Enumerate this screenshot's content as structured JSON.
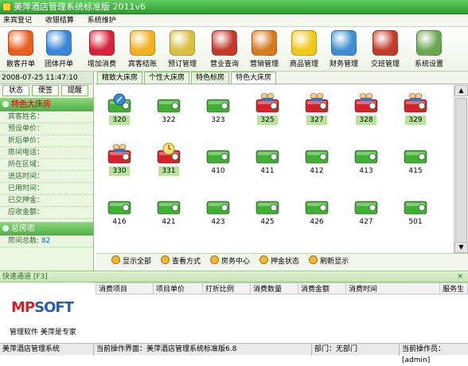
{
  "window": {
    "title": "美萍酒店管理系统标准版 2011v6"
  },
  "menu": [
    "来宾登记",
    "收银结算",
    "系统维护"
  ],
  "toolbar": [
    {
      "label": "散客开单",
      "icon": "guest-icon",
      "color": "#e85f20"
    },
    {
      "label": "团体开单",
      "icon": "group-icon",
      "color": "#3a86d8"
    },
    {
      "label": "增加消费",
      "icon": "plus-icon",
      "color": "#d8203a"
    },
    {
      "label": "宾客结账",
      "icon": "money-icon",
      "color": "#f2b01c"
    },
    {
      "label": "预订管理",
      "icon": "clock-icon",
      "color": "#d9c040"
    },
    {
      "label": "营业查询",
      "icon": "search-icon",
      "color": "#c4392b"
    },
    {
      "label": "营销管理",
      "icon": "people-icon",
      "color": "#d87a20"
    },
    {
      "label": "商品管理",
      "icon": "star-icon",
      "color": "#f0c818"
    },
    {
      "label": "财务管理",
      "icon": "books-icon",
      "color": "#3c8fd0"
    },
    {
      "label": "交班管理",
      "icon": "exit-icon",
      "color": "#c23a2a"
    },
    {
      "label": "系统设置",
      "icon": "gear-icon",
      "color": "#6aa84f"
    }
  ],
  "datetime": "2008-07-25 11:47:10",
  "left_tabs": [
    "状态",
    "便签",
    "提醒"
  ],
  "room_section_title": "特色大床房",
  "info_labels": [
    "宾客姓名：",
    "预设单价：",
    "折后单价：",
    "房间电话：",
    "所在区域：",
    "进店时间：",
    "已用时间：",
    "已交押金：",
    "应收金额："
  ],
  "overview": {
    "title": "总房态",
    "label": "房间总数:",
    "value": "82"
  },
  "quick_channel": "快速通道 [F3]",
  "room_tabs": [
    "精致大床房",
    "个性大床房",
    "特色标房",
    "特色大床房"
  ],
  "rooms": [
    {
      "number": "320",
      "status": "vacant-dirty",
      "highlight": true
    },
    {
      "number": "322",
      "status": "vacant",
      "highlight": false
    },
    {
      "number": "323",
      "status": "vacant",
      "highlight": false
    },
    {
      "number": "325",
      "status": "occupied",
      "highlight": true
    },
    {
      "number": "327",
      "status": "occupied",
      "highlight": true
    },
    {
      "number": "328",
      "status": "occupied",
      "highlight": true
    },
    {
      "number": "329",
      "status": "occupied",
      "highlight": true
    },
    {
      "number": "330",
      "status": "occupied",
      "highlight": true
    },
    {
      "number": "331",
      "status": "reserved",
      "highlight": true
    },
    {
      "number": "410",
      "status": "vacant",
      "highlight": false
    },
    {
      "number": "411",
      "status": "vacant",
      "highlight": false
    },
    {
      "number": "412",
      "status": "vacant",
      "highlight": false
    },
    {
      "number": "413",
      "status": "vacant",
      "highlight": false
    },
    {
      "number": "415",
      "status": "vacant",
      "highlight": false
    },
    {
      "number": "416",
      "status": "vacant",
      "highlight": false
    },
    {
      "number": "421",
      "status": "vacant",
      "highlight": false
    },
    {
      "number": "423",
      "status": "vacant",
      "highlight": false
    },
    {
      "number": "425",
      "status": "vacant",
      "highlight": false
    },
    {
      "number": "426",
      "status": "vacant",
      "highlight": false
    },
    {
      "number": "427",
      "status": "vacant",
      "highlight": false
    },
    {
      "number": "501",
      "status": "vacant",
      "highlight": false
    }
  ],
  "actions": [
    "显示全部",
    "查看方式",
    "房务中心",
    "押金状态",
    "刷新显示"
  ],
  "table_columns": [
    "消费项目",
    "项目单价",
    "打折比例",
    "消费数量",
    "消费金额",
    "消费时间",
    "服务生"
  ],
  "logo": {
    "text": "MPSOFT",
    "slogan": "管理软件 美萍是专家"
  },
  "status_bar": {
    "app": "美萍酒店管理系统",
    "current": "当前操作界面：美萍酒店管理系统标准版6.8",
    "dept": "部门：无部门",
    "operator": "当前操作员：[admin]"
  },
  "colors": {
    "green": "#4fae44",
    "room_green": "#3fb032",
    "room_red": "#d8202a",
    "highlight": "#b8e39a"
  }
}
